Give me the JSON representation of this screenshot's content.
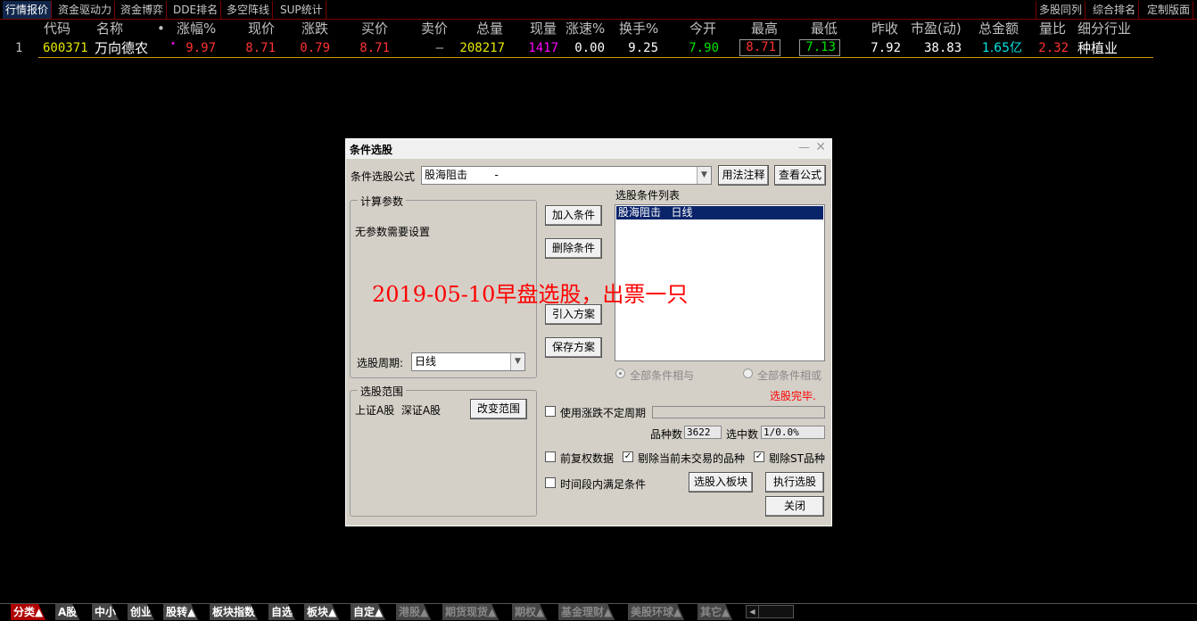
{
  "topbar": {
    "left_tabs": [
      "行情报价",
      "资金驱动力",
      "资金博弈",
      "DDE排名",
      "多空阵线",
      "SUP统计"
    ],
    "right_tabs": [
      "多股同列",
      "综合排名",
      "定制版面"
    ]
  },
  "table": {
    "headers": {
      "code": "代码",
      "name": "名称",
      "dot": "•",
      "chg_pct": "涨幅%",
      "price": "现价",
      "chg": "涨跌",
      "bid": "买价",
      "ask": "卖价",
      "volume": "总量",
      "cur_vol": "现量",
      "speed": "涨速%",
      "turnover": "换手%",
      "open": "今开",
      "high": "最高",
      "low": "最低",
      "prev_close": "昨收",
      "pe": "市盈(动)",
      "amount": "总金额",
      "vol_ratio": "量比",
      "industry": "细分行业"
    },
    "row": {
      "index": "1",
      "code": "600371",
      "name": "万向德农",
      "dot": "•",
      "chg_pct": "9.97",
      "price": "8.71",
      "chg": "0.79",
      "bid": "8.71",
      "ask": "—",
      "volume": "208217",
      "cur_vol": "1417",
      "speed": "0.00",
      "turnover": "9.25",
      "open": "7.90",
      "high": "8.71",
      "low": "7.13",
      "prev_close": "7.92",
      "pe": "38.83",
      "amount": "1.65亿",
      "vol_ratio": "2.32",
      "industry": "种植业"
    }
  },
  "dialog": {
    "title": "条件选股",
    "formula_label": "条件选股公式",
    "formula_value": "股海阻击        -",
    "usage_button": "用法注释",
    "view_button": "查看公式",
    "params_group": "计算参数",
    "params_text": "无参数需要设置",
    "period_label": "选股周期:",
    "period_value": "日线",
    "add_button": "加入条件",
    "delete_button": "删除条件",
    "import_button": "引入方案",
    "save_button": "保存方案",
    "list_label": "选股条件列表",
    "list_item": "股海阻击   日线",
    "radio_and": "全部条件相与",
    "radio_or": "全部条件相或",
    "done_text": "选股完毕.",
    "range_group": "选股范围",
    "range_text": "上证A股  深证A股",
    "change_range_button": "改变范围",
    "use_uncertain_period": "使用涨跌不定周期",
    "count_label": "品种数",
    "count_value": "3622",
    "selected_label": "选中数",
    "selected_value": "1/0.0%",
    "prior_adjust": "前复权数据",
    "exclude_untraded": "剔除当前未交易的品种",
    "exclude_st": "剔除ST品种",
    "time_range": "时间段内满足条件",
    "to_block_button": "选股入板块",
    "execute_button": "执行选股",
    "close_button": "关闭"
  },
  "overlay_text": "2019-05-10早盘选股，出票一只",
  "bottombar": {
    "tabs": [
      "分类▲",
      "A股",
      "中小",
      "创业",
      "股转▲",
      "板块指数",
      "自选",
      "板块▲",
      "自定▲",
      "港股▲",
      "期货现货▲",
      "期权▲",
      "基金理财▲",
      "美股环球▲",
      "其它▲"
    ]
  },
  "colors": {
    "up": "#ff3232",
    "down": "#00e600",
    "yellow": "#e8e800",
    "magenta": "#ff00ff",
    "cyan": "#00e6e6"
  }
}
